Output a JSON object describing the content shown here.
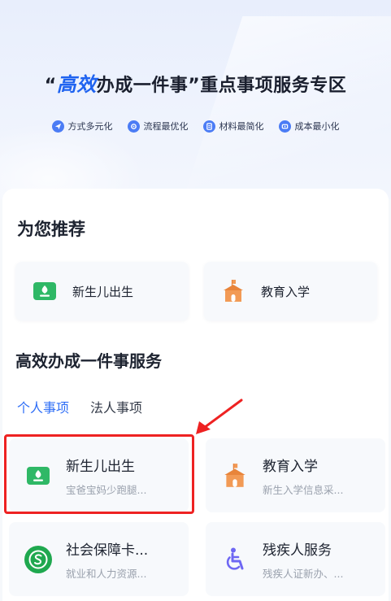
{
  "banner": {
    "title_open_quote": "“",
    "title_highlight": "高效",
    "title_rest": "办成一件事”重点事项服务专区",
    "tags": [
      {
        "label": "方式多元化",
        "icon": "send-icon"
      },
      {
        "label": "流程最优化",
        "icon": "process-icon"
      },
      {
        "label": "材料最简化",
        "icon": "document-icon"
      },
      {
        "label": "成本最小化",
        "icon": "cost-icon"
      }
    ]
  },
  "recommend": {
    "title": "为您推荐",
    "items": [
      {
        "label": "新生儿出生",
        "icon": "newborn-icon"
      },
      {
        "label": "教育入学",
        "icon": "school-icon"
      }
    ]
  },
  "services": {
    "title": "高效办成一件事服务",
    "tabs": [
      {
        "label": "个人事项",
        "active": true
      },
      {
        "label": "法人事项",
        "active": false
      }
    ],
    "items": [
      {
        "name": "新生儿出生",
        "desc": "宝爸宝妈少跑腿...",
        "icon": "newborn-icon"
      },
      {
        "name": "教育入学",
        "desc": "新生入学信息采...",
        "icon": "school-icon"
      },
      {
        "name": "社会保障卡...",
        "desc": "就业和人力资源...",
        "icon": "social-security-icon"
      },
      {
        "name": "残疾人服务",
        "desc": "残疾人证新办、...",
        "icon": "accessibility-icon"
      }
    ]
  },
  "colors": {
    "accent": "#2e6ef6",
    "highlight_box": "#ee2222",
    "banner_blue": "#1f63f0",
    "newborn_green": "#2fb866",
    "school_orange": "#f29a55",
    "accessibility_purple": "#6e67f3"
  }
}
